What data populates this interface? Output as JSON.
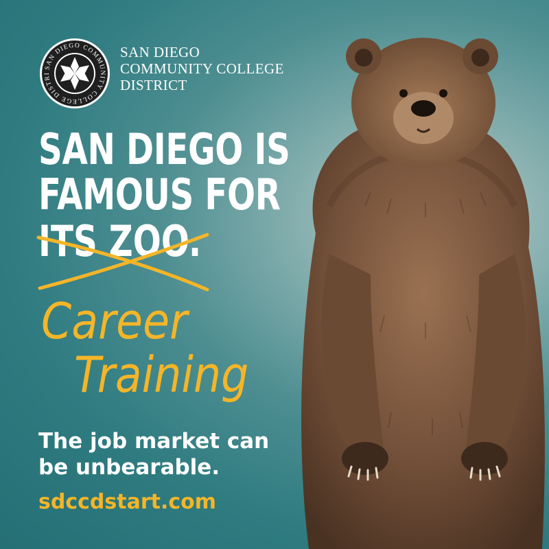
{
  "logo": {
    "seal_text": "SAN DIEGO COMMUNITY COLLEGE DISTRICT",
    "icon": "star-seal-icon"
  },
  "district": {
    "line1": "SAN DIEGO",
    "line2": "COMMUNITY COLLEGE",
    "line3": "DISTRICT"
  },
  "headline": {
    "line1": "SAN DIEGO IS",
    "line2": "FAMOUS FOR",
    "struck": "ITS ZOO."
  },
  "script": {
    "line1": "Career",
    "line2": "Training"
  },
  "tagline": {
    "line1": "The job market can",
    "line2": "be unbearable."
  },
  "url": "sdccdstart.com",
  "colors": {
    "accent": "#f5b528",
    "background": "#2e7b80",
    "text": "#ffffff"
  },
  "image": {
    "subject": "bear-illustration"
  }
}
